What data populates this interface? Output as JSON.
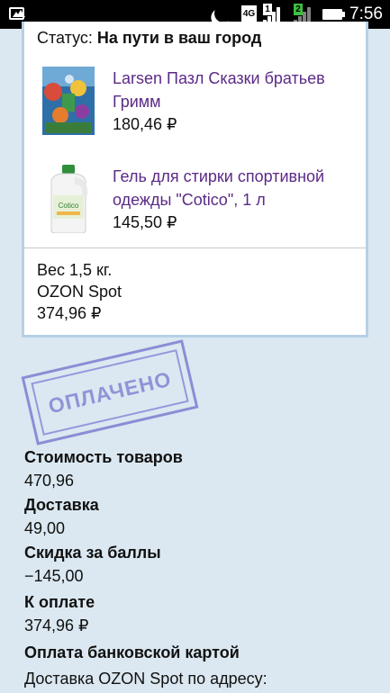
{
  "status_bar": {
    "network": "4G",
    "sim1": "1",
    "sim2": "2",
    "time": "7:56"
  },
  "order": {
    "status_label": "Статус:",
    "status_value": "На пути в ваш город",
    "items": [
      {
        "title": "Larsen Пазл Сказки братьев Гримм",
        "price": "180,46 ₽"
      },
      {
        "title": "Гель для стирки спортивной одежды \"Cotico\", 1 л",
        "price": "145,50 ₽"
      }
    ],
    "weight": "Вес 1,5 кг.",
    "delivery_method": "OZON Spot",
    "delivery_total": "374,96 ₽"
  },
  "stamp": {
    "text": "ОПЛАЧЕНО",
    "color": "#8585d3"
  },
  "summary": {
    "goods_cost_label": "Стоимость товаров",
    "goods_cost_value": "470,96",
    "shipping_label": "Доставка",
    "shipping_value": "49,00",
    "discount_label": "Скидка за баллы",
    "discount_value": "−145,00",
    "total_label": "К оплате",
    "total_value": "374,96 ₽",
    "payment_method": "Оплата банковской картой",
    "delivery_address": "Доставка OZON Spot по адресу:"
  },
  "colors": {
    "link": "#5b2a86",
    "background": "#dbe8f1",
    "card_border": "#b7d0e5"
  }
}
